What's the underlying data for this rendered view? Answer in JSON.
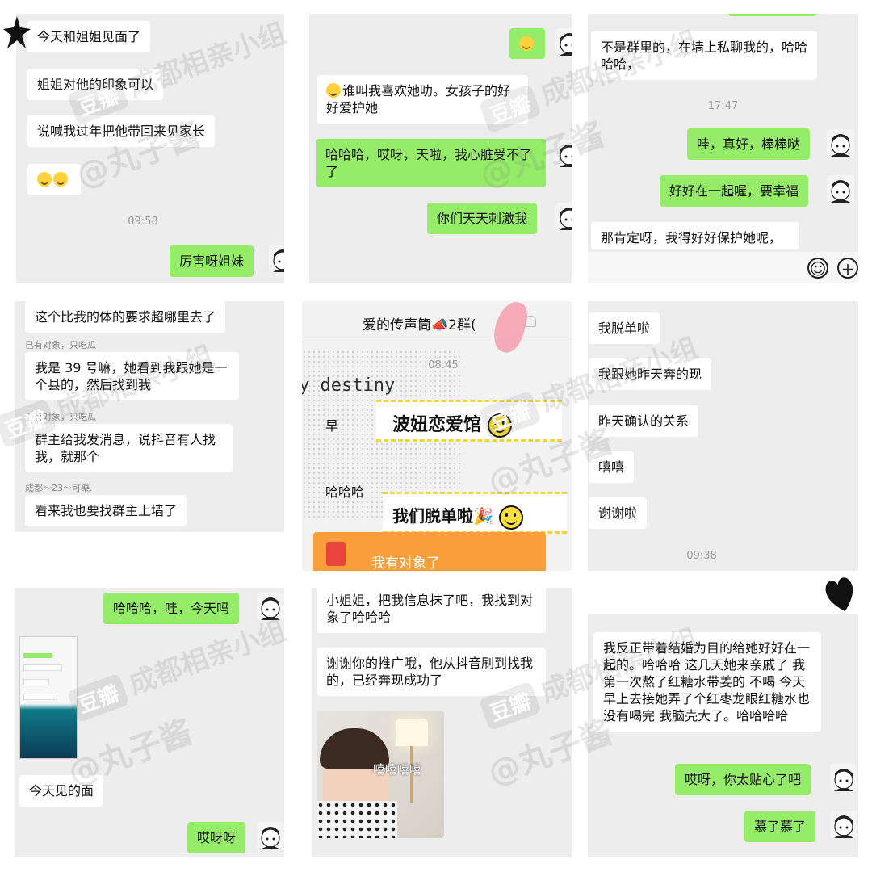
{
  "panels": {
    "p1": {
      "msgs": [
        "今天和姐姐见面了",
        "姐姐对他的印象可以",
        "说喊我过年把他带回来见家长"
      ],
      "time": "09:58",
      "reply": "厉害呀姐妹"
    },
    "p2": {
      "msg1": "谁叫我喜欢她叻。女孩子的好好爱护她",
      "reply1": "哈哈哈，哎呀，天啦，我心脏受不了了",
      "reply2": "你们天天刺激我"
    },
    "p3": {
      "msg1": "不是群里的，在墙上私聊我的，哈哈哈哈，",
      "time": "17:47",
      "reply1": "哇，真好，棒棒哒",
      "reply2": "好好在一起喔，要幸福",
      "msg2": "那肯定呀，我得好好保护她呢，"
    },
    "p4": {
      "msg1": "这个比我的体的要求超哪里去了",
      "name1": "已有对象，只吃瓜",
      "msg2": "我是 39 号嘛，她看到我跟她是一个县的，然后找到我",
      "name2": "已有对象，只吃瓜",
      "msg3": "群主给我发消息，说抖音有人找我，就那个",
      "name3": "成都～23～可樂.",
      "msg4": "看来我也要找群主上墙了"
    },
    "p5": {
      "title": "爱的传声筒📣2群(",
      "time": "08:45",
      "bg_text": "y destiny",
      "msg1": "早",
      "sticker1": "波妞恋爱馆",
      "msg2": "哈哈哈",
      "sticker2": "我们脱单啦🎉",
      "redpacket": "我有对象了"
    },
    "p6": {
      "msgs": [
        "我脱单啦",
        "我跟她昨天奔的现",
        "昨天确认的关系",
        "嘻嘻",
        "谢谢啦"
      ],
      "time": "09:38"
    },
    "p7": {
      "reply1": "哈哈哈，哇，今天吗",
      "msg1": "今天见的面",
      "reply2": "哎呀呀"
    },
    "p8": {
      "msg1": "小姐姐，把我信息抹了吧，我找到对象了哈哈哈",
      "msg2": "谢谢你的推广哦，他从抖音刷到找我的，已经奔现成功了",
      "image_caption": "嘻嘻嘻嘻"
    },
    "p9": {
      "msg1": "我反正带着结婚为目的给她好好在一起的。哈哈哈 这几天她来亲戚了 我第一次熬了红糖水带姜的 不喝 今天早上去接她弄了个红枣龙眼红糖水也没有喝完 我脑壳大了。哈哈哈哈",
      "reply1": "哎呀，你太贴心了吧",
      "reply2": "慕了慕了"
    }
  },
  "watermark": {
    "tag": "豆瓣",
    "group": "成都相亲小组",
    "author": "@丸子酱"
  },
  "colors": {
    "green": "#95ec69",
    "panel_bg": "#ededed"
  }
}
